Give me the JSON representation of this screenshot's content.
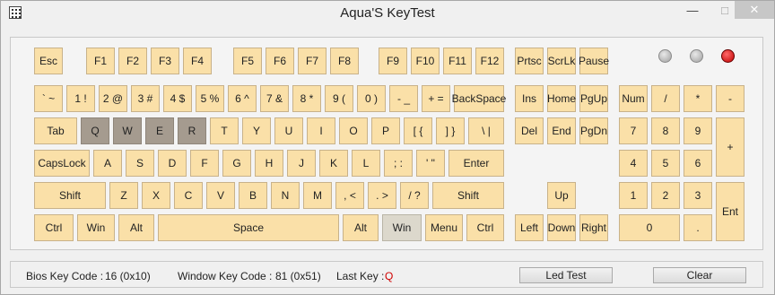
{
  "window": {
    "title": "Aqua'S KeyTest",
    "min_glyph": "—",
    "max_glyph": "□",
    "close_glyph": "✕"
  },
  "keys": {
    "esc": "Esc",
    "f1": "F1",
    "f2": "F2",
    "f3": "F3",
    "f4": "F4",
    "f5": "F5",
    "f6": "F6",
    "f7": "F7",
    "f8": "F8",
    "f9": "F9",
    "f10": "F10",
    "f11": "F11",
    "f12": "F12",
    "prtsc": "Prtsc",
    "scrlk": "ScrLk",
    "pause": "Pause",
    "backtick": "` ~",
    "d1": "1 !",
    "d2": "2 @",
    "d3": "3 #",
    "d4": "4 $",
    "d5": "5 %",
    "d6": "6 ^",
    "d7": "7 &",
    "d8": "8 *",
    "d9": "9 (",
    "d0": "0 )",
    "minus": "- _",
    "equal": "+ =",
    "backspace": "BackSpace",
    "ins": "Ins",
    "home": "Home",
    "pgup": "PgUp",
    "num": "Num",
    "kp_div": "/",
    "kp_mul": "*",
    "kp_minus": "-",
    "tab": "Tab",
    "q": "Q",
    "w": "W",
    "e": "E",
    "r": "R",
    "t": "T",
    "y": "Y",
    "u": "U",
    "i": "I",
    "o": "O",
    "p": "P",
    "lbracket": "[ {",
    "rbracket": "] }",
    "backslash": "\\ |",
    "del": "Del",
    "end": "End",
    "pgdn": "PgDn",
    "kp7": "7",
    "kp8": "8",
    "kp9": "9",
    "kp_plus": "+",
    "caps": "CapsLock",
    "a": "A",
    "s": "S",
    "d": "D",
    "f": "F",
    "g": "G",
    "h": "H",
    "j": "J",
    "k": "K",
    "l": "L",
    "semicolon": "; :",
    "quote": "' \"",
    "enter": "Enter",
    "kp4": "4",
    "kp5": "5",
    "kp6": "6",
    "lshift": "Shift",
    "z": "Z",
    "x": "X",
    "c": "C",
    "v": "V",
    "b": "B",
    "n": "N",
    "m": "M",
    "comma": ", <",
    "period": ". >",
    "slash": "/ ?",
    "rshift": "Shift",
    "up": "Up",
    "kp1": "1",
    "kp2": "2",
    "kp3": "3",
    "kp_enter": "Ent",
    "lctrl": "Ctrl",
    "lwin": "Win",
    "lalt": "Alt",
    "space": "Space",
    "ralt": "Alt",
    "rwin": "Win",
    "menu": "Menu",
    "rctrl": "Ctrl",
    "left": "Left",
    "down": "Down",
    "right": "Right",
    "kp0": "0",
    "kp_dot": "."
  },
  "pressed_keys": [
    "q",
    "w",
    "e",
    "r"
  ],
  "highlighted_keys": [
    "rwin"
  ],
  "leds": {
    "num_lock": "off",
    "caps_lock": "off",
    "scroll_lock": "on"
  },
  "colors": {
    "key": "#fae0a8",
    "pressed": "#a59b8f",
    "led_on": "#d00000",
    "last_key": "#d00000"
  },
  "status": {
    "bios_label": "Bios Key Code :",
    "bios_value": "16 (0x10)",
    "window_label": "Window Key Code :",
    "window_value": "81 (0x51)",
    "last_label": "Last Key :",
    "last_value": "Q"
  },
  "buttons": {
    "led_test": "Led Test",
    "clear": "Clear"
  }
}
